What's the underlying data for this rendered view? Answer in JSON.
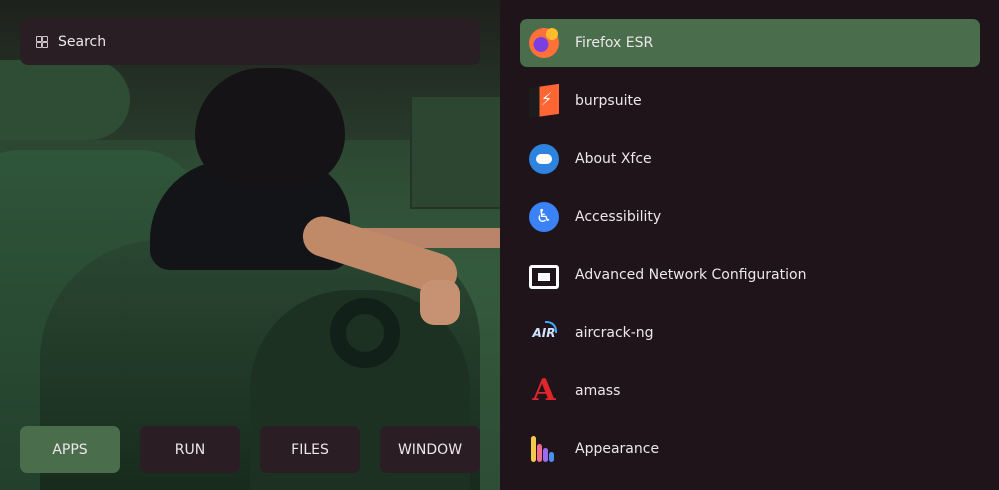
{
  "search": {
    "placeholder": "Search",
    "icon": "grid-icon"
  },
  "tabs": [
    {
      "label": "APPS",
      "active": true
    },
    {
      "label": "RUN",
      "active": false
    },
    {
      "label": "FILES",
      "active": false
    },
    {
      "label": "WINDOW",
      "active": false
    }
  ],
  "apps": [
    {
      "label": "Firefox ESR",
      "icon": "firefox-icon",
      "selected": true
    },
    {
      "label": "burpsuite",
      "icon": "burpsuite-icon",
      "selected": false
    },
    {
      "label": "About Xfce",
      "icon": "xfce-icon",
      "selected": false
    },
    {
      "label": "Accessibility",
      "icon": "accessibility-icon",
      "selected": false
    },
    {
      "label": "Advanced Network Configuration",
      "icon": "network-icon",
      "selected": false
    },
    {
      "label": "aircrack-ng",
      "icon": "aircrack-icon",
      "selected": false
    },
    {
      "label": "amass",
      "icon": "amass-icon",
      "selected": false
    },
    {
      "label": "Appearance",
      "icon": "appearance-icon",
      "selected": false
    }
  ],
  "colors": {
    "selected": "#4a6d4c",
    "panel": "#1f1419",
    "tab": "#2a1e24"
  }
}
